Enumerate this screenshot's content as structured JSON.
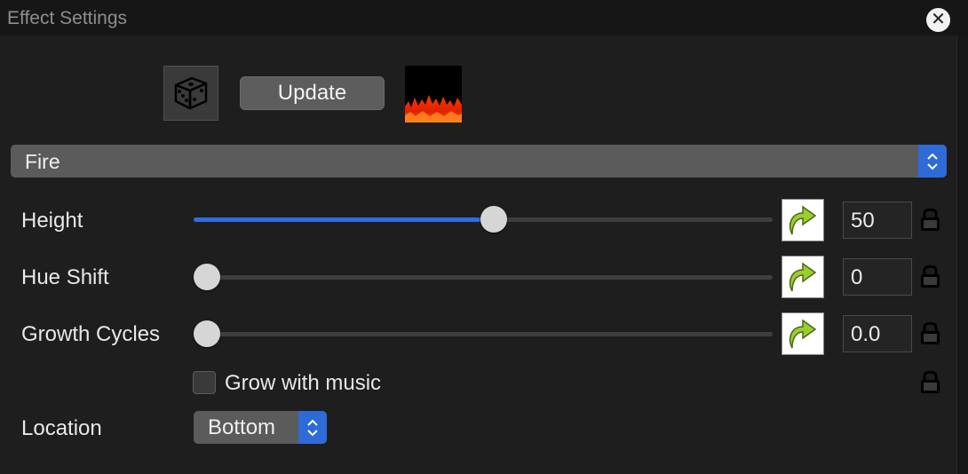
{
  "window": {
    "title": "Effect Settings"
  },
  "toolbar": {
    "randomize_icon": "dice-icon",
    "update_label": "Update",
    "preview_icon": "fire-preview-icon"
  },
  "effect_select": {
    "value": "Fire"
  },
  "rows": [
    {
      "label": "Height",
      "value": "50",
      "slider_fraction": 0.496
    },
    {
      "label": "Hue Shift",
      "value": "0",
      "slider_fraction": 0.0
    },
    {
      "label": "Growth Cycles",
      "value": "0.0",
      "slider_fraction": 0.0
    }
  ],
  "checkbox": {
    "label": "Grow with music",
    "checked": false
  },
  "location": {
    "label": "Location",
    "value": "Bottom"
  },
  "colors": {
    "accent": "#2f6de0",
    "background": "#1e1e1e"
  }
}
